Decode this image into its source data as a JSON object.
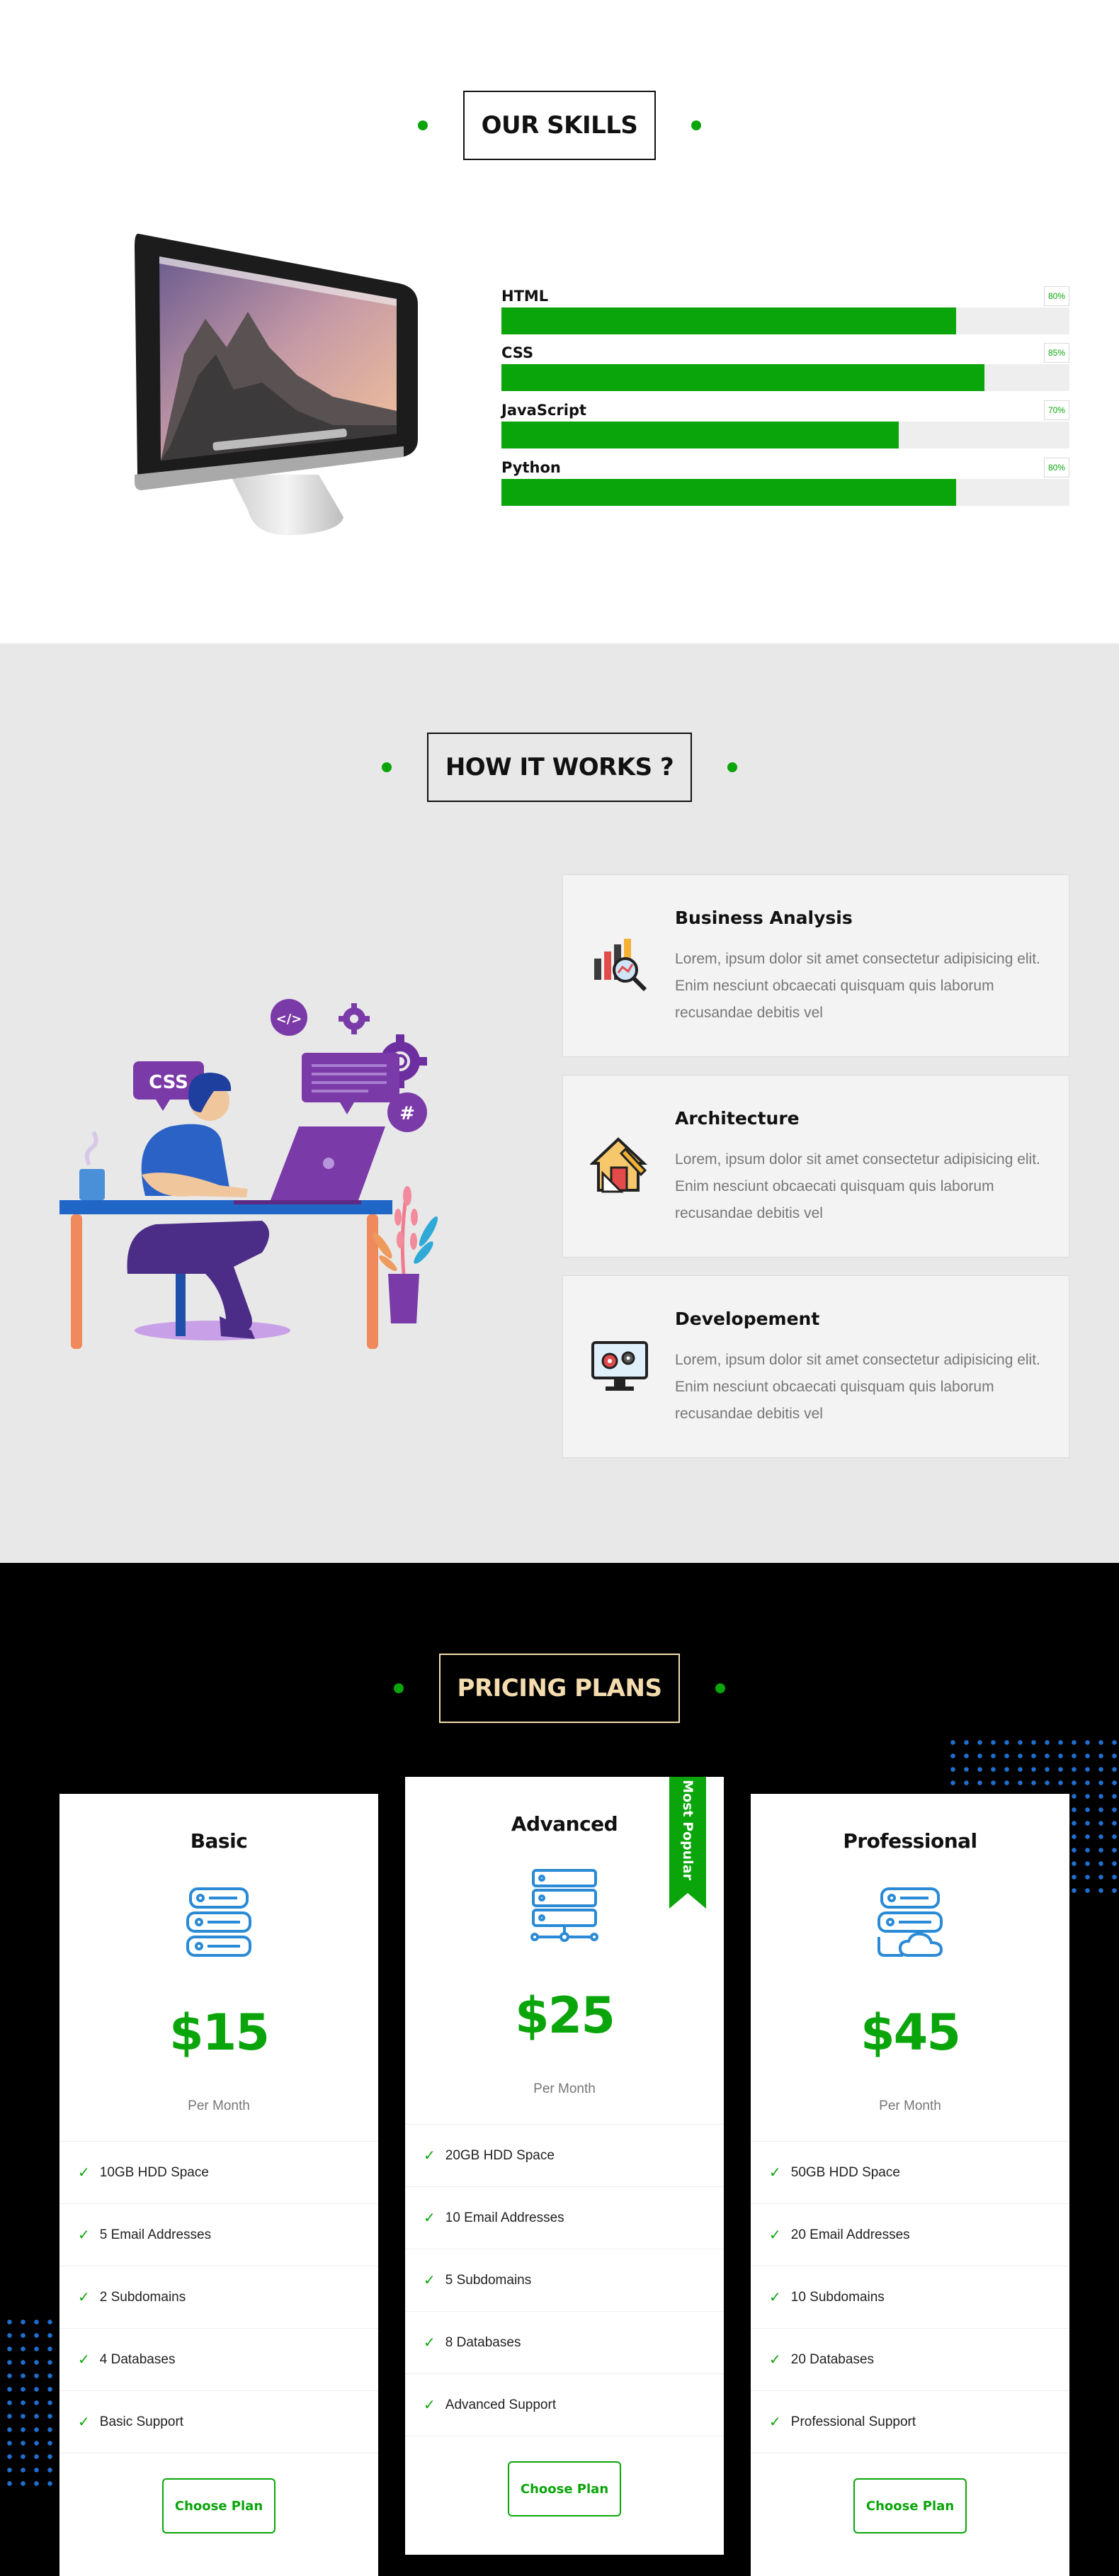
{
  "skills": {
    "title": "OUR SKILLS",
    "items": [
      {
        "name": "HTML",
        "percent_label": "80%",
        "value": 80
      },
      {
        "name": "CSS",
        "percent_label": "85%",
        "value": 85
      },
      {
        "name": "JavaScript",
        "percent_label": "70%",
        "value": 70
      },
      {
        "name": "Python",
        "percent_label": "80%",
        "value": 80
      }
    ]
  },
  "how": {
    "title": "HOW IT WORKS ?",
    "illustration_text": {
      "css_label": "CSS",
      "code_icon": "</>",
      "hash_icon": "#"
    },
    "steps": [
      {
        "title": "Business Analysis",
        "description": "Lorem, ipsum dolor sit amet consectetur adipisicing elit. Enim nesciunt obcaecati quisquam quis laborum recusandae debitis vel",
        "icon": "analytics-icon"
      },
      {
        "title": "Architecture",
        "description": "Lorem, ipsum dolor sit amet consectetur adipisicing elit. Enim nesciunt obcaecati quisquam quis laborum recusandae debitis vel",
        "icon": "architecture-icon"
      },
      {
        "title": "Developement",
        "description": "Lorem, ipsum dolor sit amet consectetur adipisicing elit. Enim nesciunt obcaecati quisquam quis laborum recusandae debitis vel",
        "icon": "development-icon"
      }
    ]
  },
  "pricing": {
    "title": "PRICING PLANS",
    "plans": [
      {
        "name": "Basic",
        "price": "$15",
        "period": "Per Month",
        "icon": "server-icon",
        "features": [
          "10GB HDD Space",
          "5 Email Addresses",
          "2 Subdomains",
          "4 Databases",
          "Basic Support"
        ],
        "button": "Choose Plan"
      },
      {
        "name": "Advanced",
        "price": "$25",
        "period": "Per Month",
        "icon": "server-network-icon",
        "ribbon": "Most Popular",
        "features": [
          "20GB HDD Space",
          "10 Email Addresses",
          "5 Subdomains",
          "8 Databases",
          "Advanced Support"
        ],
        "button": "Choose Plan"
      },
      {
        "name": "Professional",
        "price": "$45",
        "period": "Per Month",
        "icon": "server-cloud-icon",
        "features": [
          "50GB HDD Space",
          "20 Email Addresses",
          "10 Subdomains",
          "20 Databases",
          "Professional Support"
        ],
        "button": "Choose Plan"
      }
    ]
  },
  "colors": {
    "accent": "#0aa50a",
    "pricing_title": "#f4dcaf",
    "dots": "#1f6fd1",
    "illustration_purple": "#7a3aa8"
  }
}
